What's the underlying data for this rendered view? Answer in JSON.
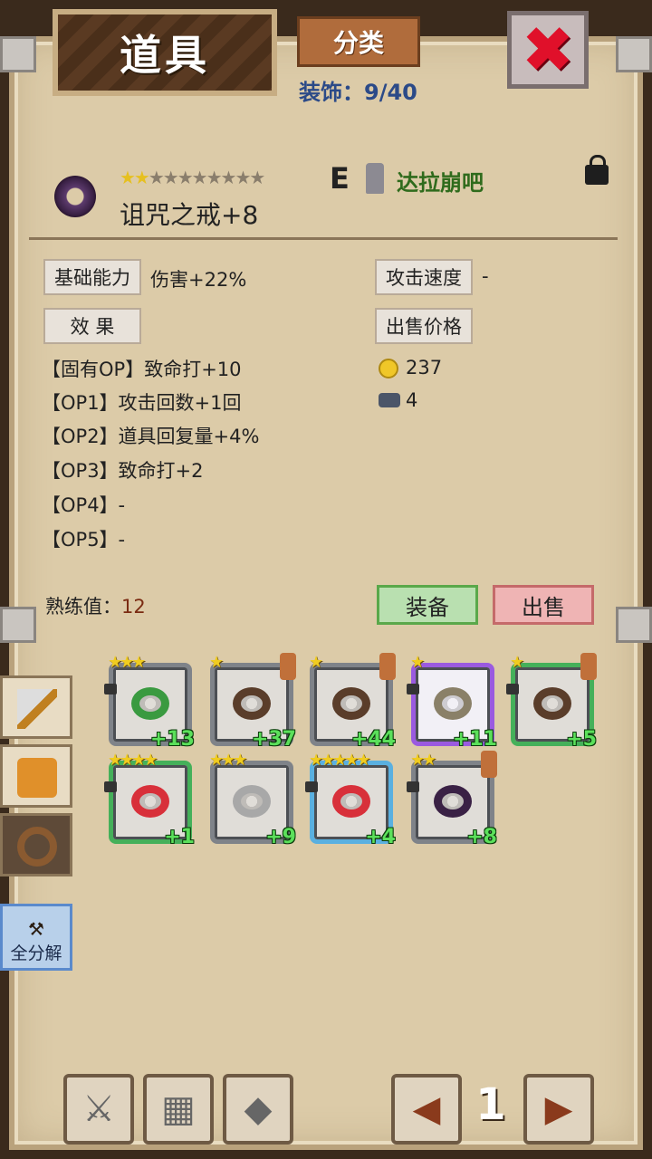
{
  "header": {
    "title": "道具",
    "category_label": "分类",
    "count_label": "装饰：9/40",
    "close_icon": "close-x-icon"
  },
  "item": {
    "name": "诅咒之戒+8",
    "stars_on": "★★",
    "stars_off": "★★★★★★★★",
    "grade": "E",
    "owner": "达拉崩吧",
    "locked": true,
    "base_label": "基础能力",
    "base_value": "伤害+22%",
    "speed_label": "攻击速度",
    "speed_value": "-",
    "effect_label": "效 果",
    "price_label": "出售价格",
    "price_gold": "237",
    "price_ore": "4",
    "options": [
      "【固有OP】致命打+10",
      "【OP1】攻击回数+1回",
      "【OP2】道具回复量+4%",
      "【OP3】致命打+2",
      "【OP4】-",
      "【OP5】-"
    ],
    "proficiency_label": "熟练值：",
    "proficiency_value": "12",
    "equip_label": "装备",
    "sell_label": "出售"
  },
  "inventory": [
    {
      "stars": "★★★",
      "plus": "+13",
      "color": "#3a9a40",
      "frame": "gray",
      "hero": false
    },
    {
      "stars": "★",
      "plus": "+37",
      "color": "#5a3d2a",
      "frame": "gray",
      "hero": true
    },
    {
      "stars": "★",
      "plus": "+44",
      "color": "#5a3d2a",
      "frame": "gray",
      "hero": true
    },
    {
      "stars": "★",
      "plus": "+11",
      "color": "#8a8068",
      "frame": "purple",
      "hero": false
    },
    {
      "stars": "★",
      "plus": "+5",
      "color": "#5a3d2a",
      "frame": "green",
      "hero": true
    },
    {
      "stars": "★★★★",
      "plus": "+1",
      "color": "#d8303a",
      "frame": "green",
      "hero": false
    },
    {
      "stars": "★★★",
      "plus": "+9",
      "color": "#a8a8a8",
      "frame": "gray",
      "hero": false
    },
    {
      "stars": "★★★★★",
      "plus": "+4",
      "color": "#d8303a",
      "frame": "blue",
      "hero": false
    },
    {
      "stars": "★★",
      "plus": "+8",
      "color": "#3a2145",
      "frame": "gray",
      "hero": true
    }
  ],
  "side": {
    "dismantle_label": "全分解"
  },
  "pager": {
    "page": "1"
  }
}
